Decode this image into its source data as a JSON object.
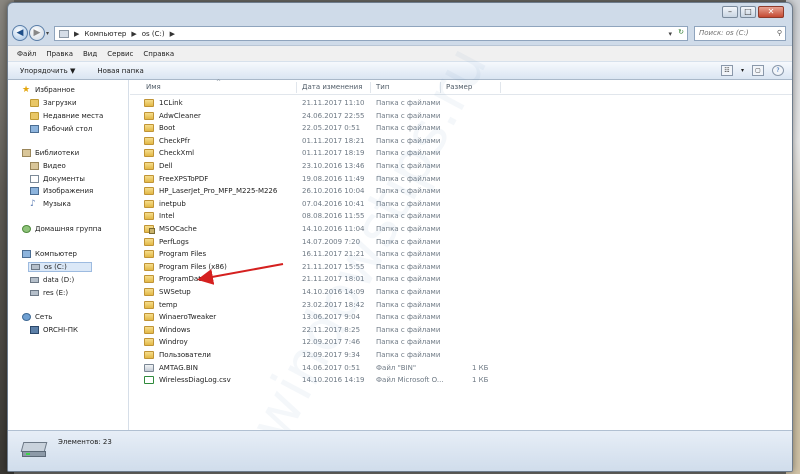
{
  "address": {
    "back_icon": "back-arrow-icon",
    "crumbs": [
      "Компьютер",
      "os (C:)"
    ],
    "search_placeholder": "Поиск: os (C:)"
  },
  "menu": [
    "Файл",
    "Правка",
    "Вид",
    "Сервис",
    "Справка"
  ],
  "toolbar": {
    "organize": "Упорядочить ▼",
    "new_folder": "Новая папка"
  },
  "nav": {
    "favorites": "Избранное",
    "downloads": "Загрузки",
    "recent": "Недавние места",
    "desktop": "Рабочий стол",
    "libraries": "Библиотеки",
    "video": "Видео",
    "documents": "Документы",
    "images": "Изображения",
    "music": "Музыка",
    "homegroup": "Домашняя группа",
    "computer": "Компьютер",
    "drive_c": "os (C:)",
    "drive_d": "data (D:)",
    "drive_e": "res (E:)",
    "network": "Сеть",
    "pc": "ORCHI-ПК"
  },
  "columns": {
    "name": "Имя",
    "date": "Дата изменения",
    "type": "Тип",
    "size": "Размер"
  },
  "files": [
    {
      "name": "1CLink",
      "date": "21.11.2017 11:10",
      "type": "Папка с файлами",
      "size": "",
      "kind": "folder"
    },
    {
      "name": "AdwCleaner",
      "date": "24.06.2017 22:55",
      "type": "Папка с файлами",
      "size": "",
      "kind": "folder"
    },
    {
      "name": "Boot",
      "date": "22.05.2017 0:51",
      "type": "Папка с файлами",
      "size": "",
      "kind": "folder"
    },
    {
      "name": "CheckPfr",
      "date": "01.11.2017 18:21",
      "type": "Папка с файлами",
      "size": "",
      "kind": "folder"
    },
    {
      "name": "CheckXml",
      "date": "01.11.2017 18:19",
      "type": "Папка с файлами",
      "size": "",
      "kind": "folder"
    },
    {
      "name": "Dell",
      "date": "23.10.2016 13:46",
      "type": "Папка с файлами",
      "size": "",
      "kind": "folder"
    },
    {
      "name": "FreeXPSToPDF",
      "date": "19.08.2016 11:49",
      "type": "Папка с файлами",
      "size": "",
      "kind": "folder"
    },
    {
      "name": "HP_LaserJet_Pro_MFP_M225-M226",
      "date": "26.10.2016 10:04",
      "type": "Папка с файлами",
      "size": "",
      "kind": "folder"
    },
    {
      "name": "inetpub",
      "date": "07.04.2016 10:41",
      "type": "Папка с файлами",
      "size": "",
      "kind": "folder"
    },
    {
      "name": "Intel",
      "date": "08.08.2016 11:55",
      "type": "Папка с файлами",
      "size": "",
      "kind": "folder"
    },
    {
      "name": "MSOCache",
      "date": "14.10.2016 11:04",
      "type": "Папка с файлами",
      "size": "",
      "kind": "lock"
    },
    {
      "name": "PerfLogs",
      "date": "14.07.2009 7:20",
      "type": "Папка с файлами",
      "size": "",
      "kind": "folder"
    },
    {
      "name": "Program Files",
      "date": "16.11.2017 21:21",
      "type": "Папка с файлами",
      "size": "",
      "kind": "folder"
    },
    {
      "name": "Program Files (x86)",
      "date": "21.11.2017 15:55",
      "type": "Папка с файлами",
      "size": "",
      "kind": "folder"
    },
    {
      "name": "ProgramData",
      "date": "21.11.2017 18:01",
      "type": "Папка с файлами",
      "size": "",
      "kind": "folder"
    },
    {
      "name": "SWSetup",
      "date": "14.10.2016 14:09",
      "type": "Папка с файлами",
      "size": "",
      "kind": "folder"
    },
    {
      "name": "temp",
      "date": "23.02.2017 18:42",
      "type": "Папка с файлами",
      "size": "",
      "kind": "folder"
    },
    {
      "name": "WinaeroTweaker",
      "date": "13.06.2017 9:04",
      "type": "Папка с файлами",
      "size": "",
      "kind": "folder"
    },
    {
      "name": "Windows",
      "date": "22.11.2017 8:25",
      "type": "Папка с файлами",
      "size": "",
      "kind": "folder"
    },
    {
      "name": "Windroy",
      "date": "12.09.2017 7:46",
      "type": "Папка с файлами",
      "size": "",
      "kind": "folder"
    },
    {
      "name": "Пользователи",
      "date": "12.09.2017 9:34",
      "type": "Папка с файлами",
      "size": "",
      "kind": "folder"
    },
    {
      "name": "AMTAG.BIN",
      "date": "14.06.2017 0:51",
      "type": "Файл \"BIN\"",
      "size": "1 КБ",
      "kind": "sys"
    },
    {
      "name": "WirelessDiagLog.csv",
      "date": "14.10.2016 14:19",
      "type": "Файл Microsoft O...",
      "size": "1 КБ",
      "kind": "csv"
    }
  ],
  "status": {
    "items_count": "Элементов: 23"
  },
  "colors": {
    "arrow": "#d5201f",
    "window_frame": "#cfdbe9"
  }
}
